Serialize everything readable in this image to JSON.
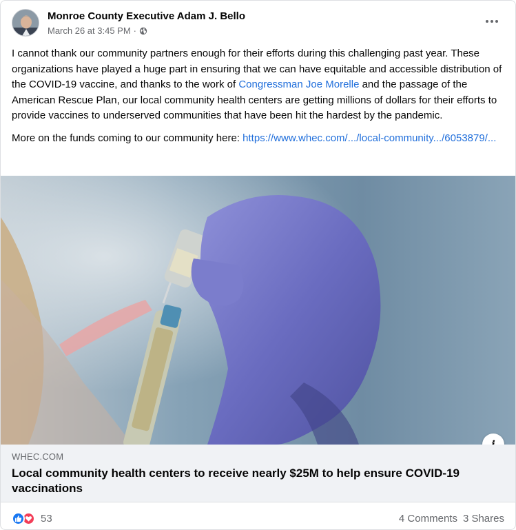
{
  "post": {
    "author": "Monroe County Executive Adam J. Bello",
    "timestamp": "March 26 at 3:45 PM",
    "separator": "·",
    "privacy_icon": "globe-icon",
    "more_icon": "more-horizontal-icon",
    "body": {
      "p1_before": "I cannot thank our community partners enough for their efforts during this challenging past year. These organizations have played a huge part in ensuring that we can have equitable and accessible distribution of the COVID-19 vaccine, and thanks to the work of ",
      "p1_mention": "Congressman Joe Morelle",
      "p1_after": " and the passage of the American Rescue Plan, our local community health centers are getting millions of dollars for their efforts to provide vaccines to underserved communities that have been hit the hardest by the pandemic.",
      "p2_before": "More on the funds coming to our community here: ",
      "p2_link": "https://www.whec.com/.../local-community.../6053879/..."
    }
  },
  "link_preview": {
    "domain": "WHEC.COM",
    "headline": "Local community health centers to receive nearly $25M to help ensure COVID-19 vaccinations",
    "info_label": "i"
  },
  "footer": {
    "reaction_count": "53",
    "comments": "4 Comments",
    "shares": "3 Shares"
  },
  "colors": {
    "link": "#216fdb",
    "like": "#1877f2",
    "love": "#f33e58",
    "secondary_text": "#65676b",
    "preview_bg": "#f0f2f5"
  }
}
